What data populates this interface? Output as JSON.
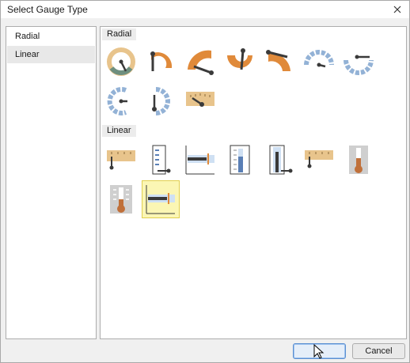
{
  "window": {
    "title": "Select Gauge Type"
  },
  "categories": [
    {
      "label": "Radial",
      "selected": false
    },
    {
      "label": "Linear",
      "selected": true
    }
  ],
  "groups": {
    "radial": {
      "label": "Radial"
    },
    "linear": {
      "label": "Linear"
    }
  },
  "buttons": {
    "ok_label": "",
    "cancel_label": "Cancel"
  },
  "colors": {
    "orange": "#e08a3a",
    "tan": "#e8c48c",
    "steel_blue": "#93b2d6",
    "needle": "#3a3a3a",
    "selection_fill": "#fbf6b4"
  }
}
